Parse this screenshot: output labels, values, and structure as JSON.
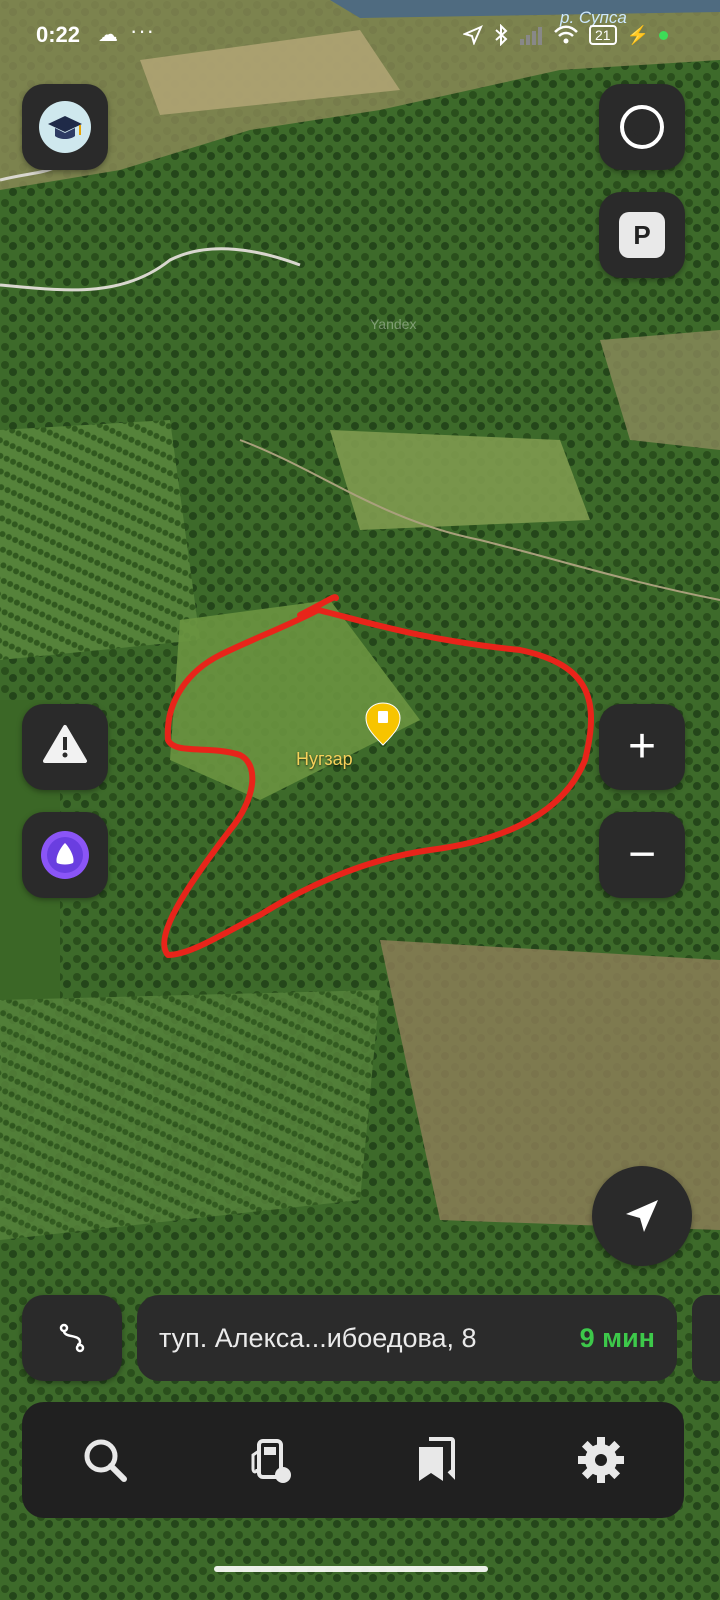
{
  "status_bar": {
    "time": "0:22",
    "river_label": "р. Супса",
    "battery": "21"
  },
  "map": {
    "watermark": "Yandex",
    "place_label": "Нугзар",
    "outline_color": "#e8241a",
    "pin_color": "#f7c400"
  },
  "controls": {
    "academy": "graduation-cap",
    "layers": "circle-layer",
    "parking": "P",
    "alert": "warning",
    "assistant": "alice",
    "zoom_in": "+",
    "zoom_out": "−",
    "locate": "navigation-arrow"
  },
  "route": {
    "address": "туп. Алекса...ибоедова, 8",
    "eta": "9 мин"
  },
  "tabbar": {
    "items": [
      "search",
      "fuel",
      "bookmarks",
      "settings"
    ]
  },
  "colors": {
    "accent_green": "#3dc84a",
    "panel": "#2b2b2b"
  }
}
